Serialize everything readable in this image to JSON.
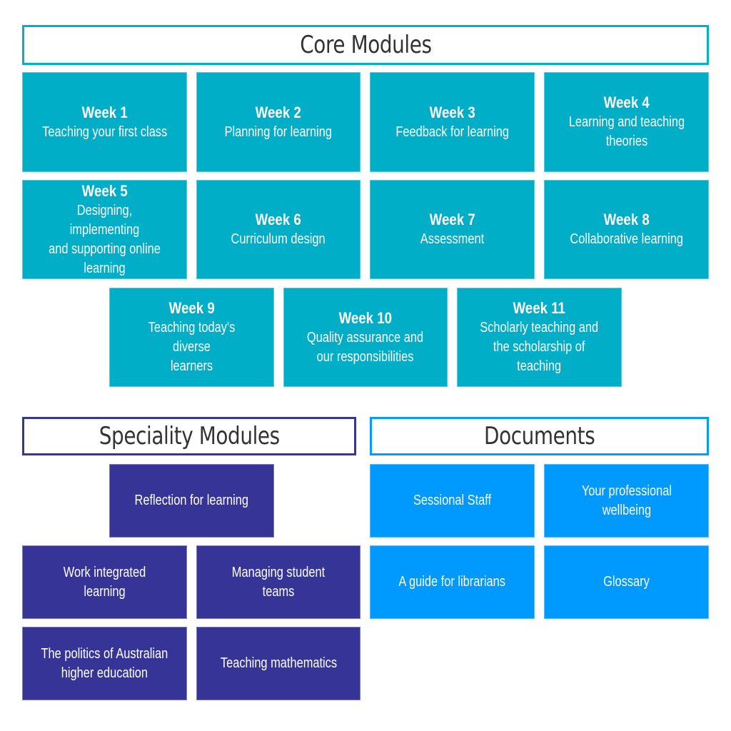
{
  "colors": {
    "core": "#01aec7",
    "speciality": "#363597",
    "documents": "#0099fd",
    "header_text": "#333333"
  },
  "core": {
    "title": "Core Modules",
    "weeks": [
      {
        "week": "Week 1",
        "title": "Teaching your first class"
      },
      {
        "week": "Week 2",
        "title": "Planning for learning"
      },
      {
        "week": "Week 3",
        "title": "Feedback for learning"
      },
      {
        "week": "Week 4",
        "title": "Learning and teaching\ntheories"
      },
      {
        "week": "Week 5",
        "title": "Designing, implementing\nand supporting online\nlearning"
      },
      {
        "week": "Week 6",
        "title": "Curriculum design"
      },
      {
        "week": "Week 7",
        "title": "Assessment"
      },
      {
        "week": "Week 8",
        "title": "Collaborative learning"
      },
      {
        "week": "Week 9",
        "title": "Teaching today's diverse\nlearners"
      },
      {
        "week": "Week 10",
        "title": "Quality assurance and\nour responsibilities"
      },
      {
        "week": "Week 11",
        "title": "Scholarly teaching and\nthe scholarship of\nteaching"
      }
    ]
  },
  "speciality": {
    "title": "Speciality Modules",
    "items": [
      "Reflection for learning",
      "Work integrated learning",
      "Managing student teams",
      "The politics of Australian\nhigher education",
      "Teaching mathematics"
    ]
  },
  "documents": {
    "title": "Documents",
    "items": [
      "Sessional Staff",
      "Your professional\nwellbeing",
      "A guide for librarians",
      "Glossary"
    ]
  }
}
